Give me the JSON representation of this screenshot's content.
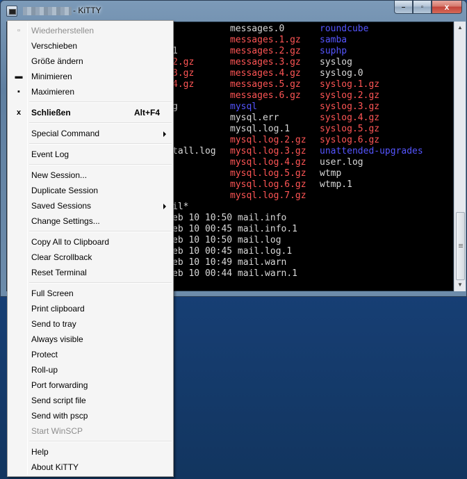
{
  "window": {
    "title": "- KiTTY",
    "buttons": {
      "minimize": "–",
      "maximize": "▫",
      "close": "x"
    }
  },
  "terminal": {
    "colors": {
      "white": "#ffffff",
      "red": "#ff5555",
      "blue": "#5555ff",
      "fg": "#d8d8d8"
    },
    "lines": [
      {
        "row": 0,
        "col": 0,
        "text": "",
        "color": "fg"
      },
      {
        "row": 0,
        "col": 1,
        "text": "messages.0",
        "color": "fg"
      },
      {
        "row": 0,
        "col": 2,
        "text": "roundcube",
        "color": "blue"
      },
      {
        "row": 1,
        "col": 1,
        "text": "messages.1.gz",
        "color": "red"
      },
      {
        "row": 1,
        "col": 2,
        "text": "samba",
        "color": "blue"
      },
      {
        "row": 2,
        "col": 0,
        "text": "1",
        "color": "fg"
      },
      {
        "row": 2,
        "col": 1,
        "text": "messages.2.gz",
        "color": "red"
      },
      {
        "row": 2,
        "col": 2,
        "text": "suphp",
        "color": "blue"
      },
      {
        "row": 3,
        "col": 0,
        "text": "2.gz",
        "color": "red"
      },
      {
        "row": 3,
        "col": 1,
        "text": "messages.3.gz",
        "color": "red"
      },
      {
        "row": 3,
        "col": 2,
        "text": "syslog",
        "color": "fg"
      },
      {
        "row": 4,
        "col": 0,
        "text": "3.gz",
        "color": "red"
      },
      {
        "row": 4,
        "col": 1,
        "text": "messages.4.gz",
        "color": "red"
      },
      {
        "row": 4,
        "col": 2,
        "text": "syslog.0",
        "color": "fg"
      },
      {
        "row": 5,
        "col": 0,
        "text": "4.gz",
        "color": "red"
      },
      {
        "row": 5,
        "col": 1,
        "text": "messages.5.gz",
        "color": "red"
      },
      {
        "row": 5,
        "col": 2,
        "text": "syslog.1.gz",
        "color": "red"
      },
      {
        "row": 6,
        "col": 1,
        "text": "messages.6.gz",
        "color": "red"
      },
      {
        "row": 6,
        "col": 2,
        "text": "syslog.2.gz",
        "color": "red"
      },
      {
        "row": 7,
        "col": 0,
        "text": "g",
        "color": "fg"
      },
      {
        "row": 7,
        "col": 1,
        "text": "mysql",
        "color": "blue"
      },
      {
        "row": 7,
        "col": 2,
        "text": "syslog.3.gz",
        "color": "red"
      },
      {
        "row": 8,
        "col": 1,
        "text": "mysql.err",
        "color": "fg"
      },
      {
        "row": 8,
        "col": 2,
        "text": "syslog.4.gz",
        "color": "red"
      },
      {
        "row": 9,
        "col": 1,
        "text": "mysql.log.1",
        "color": "fg"
      },
      {
        "row": 9,
        "col": 2,
        "text": "syslog.5.gz",
        "color": "red"
      },
      {
        "row": 10,
        "col": 1,
        "text": "mysql.log.2.gz",
        "color": "red"
      },
      {
        "row": 10,
        "col": 2,
        "text": "syslog.6.gz",
        "color": "red"
      },
      {
        "row": 11,
        "col": 0,
        "text": "tall.log",
        "color": "fg"
      },
      {
        "row": 11,
        "col": 1,
        "text": "mysql.log.3.gz",
        "color": "red"
      },
      {
        "row": 11,
        "col": 2,
        "text": "unattended-upgrades",
        "color": "blue"
      },
      {
        "row": 12,
        "col": 1,
        "text": "mysql.log.4.gz",
        "color": "red"
      },
      {
        "row": 12,
        "col": 2,
        "text": "user.log",
        "color": "fg"
      },
      {
        "row": 13,
        "col": 1,
        "text": "mysql.log.5.gz",
        "color": "red"
      },
      {
        "row": 13,
        "col": 2,
        "text": "wtmp",
        "color": "fg"
      },
      {
        "row": 14,
        "col": 1,
        "text": "mysql.log.6.gz",
        "color": "red"
      },
      {
        "row": 14,
        "col": 2,
        "text": "wtmp.1",
        "color": "fg"
      },
      {
        "row": 15,
        "col": 1,
        "text": "mysql.log.7.gz",
        "color": "red"
      },
      {
        "row": 16,
        "col": 0,
        "text": "il*",
        "color": "fg"
      },
      {
        "row": 17,
        "col": 0,
        "text": "eb 10 10:50 mail.info",
        "color": "fg"
      },
      {
        "row": 18,
        "col": 0,
        "text": "eb 10 00:45 mail.info.1",
        "color": "fg"
      },
      {
        "row": 19,
        "col": 0,
        "text": "eb 10 10:50 mail.log",
        "color": "fg"
      },
      {
        "row": 20,
        "col": 0,
        "text": "eb 10 00:45 mail.log.1",
        "color": "fg"
      },
      {
        "row": 21,
        "col": 0,
        "text": "eb 10 10:49 mail.warn",
        "color": "fg"
      },
      {
        "row": 22,
        "col": 0,
        "text": "eb 10 00:44 mail.warn.1",
        "color": "fg"
      }
    ]
  },
  "menu": {
    "items": [
      {
        "id": "restore",
        "label": "Wiederherstellen",
        "disabled": true,
        "icon": "restore-icon",
        "glyph": "▫"
      },
      {
        "id": "move",
        "label": "Verschieben"
      },
      {
        "id": "size",
        "label": "Größe ändern"
      },
      {
        "id": "minimize",
        "label": "Minimieren",
        "icon": "minimize-icon",
        "glyph": "▬"
      },
      {
        "id": "maximize",
        "label": "Maximieren",
        "icon": "maximize-icon",
        "glyph": "▪"
      },
      {
        "sep": true
      },
      {
        "id": "close",
        "label": "Schließen",
        "bold": true,
        "accel": "Alt+F4",
        "icon": "close-icon",
        "glyph": "x"
      },
      {
        "sep": true
      },
      {
        "id": "special-command",
        "label": "Special Command",
        "submenu": true
      },
      {
        "sep": true
      },
      {
        "id": "event-log",
        "label": "Event Log"
      },
      {
        "sep": true
      },
      {
        "id": "new-session",
        "label": "New Session..."
      },
      {
        "id": "duplicate-session",
        "label": "Duplicate Session"
      },
      {
        "id": "saved-sessions",
        "label": "Saved Sessions",
        "submenu": true
      },
      {
        "id": "change-settings",
        "label": "Change Settings..."
      },
      {
        "sep": true
      },
      {
        "id": "copy-all",
        "label": "Copy All to Clipboard"
      },
      {
        "id": "clear-scrollback",
        "label": "Clear Scrollback"
      },
      {
        "id": "reset-terminal",
        "label": "Reset Terminal"
      },
      {
        "sep": true
      },
      {
        "id": "full-screen",
        "label": "Full Screen"
      },
      {
        "id": "print-clipboard",
        "label": "Print clipboard"
      },
      {
        "id": "send-to-tray",
        "label": "Send to tray"
      },
      {
        "id": "always-visible",
        "label": "Always visible"
      },
      {
        "id": "protect",
        "label": "Protect"
      },
      {
        "id": "roll-up",
        "label": "Roll-up"
      },
      {
        "id": "port-forwarding",
        "label": "Port forwarding"
      },
      {
        "id": "send-script-file",
        "label": "Send script file"
      },
      {
        "id": "send-with-pscp",
        "label": "Send with pscp"
      },
      {
        "id": "start-winscp",
        "label": "Start WinSCP",
        "disabled": true
      },
      {
        "sep": true
      },
      {
        "id": "help",
        "label": "Help"
      },
      {
        "id": "about",
        "label": "About KiTTY"
      }
    ]
  }
}
